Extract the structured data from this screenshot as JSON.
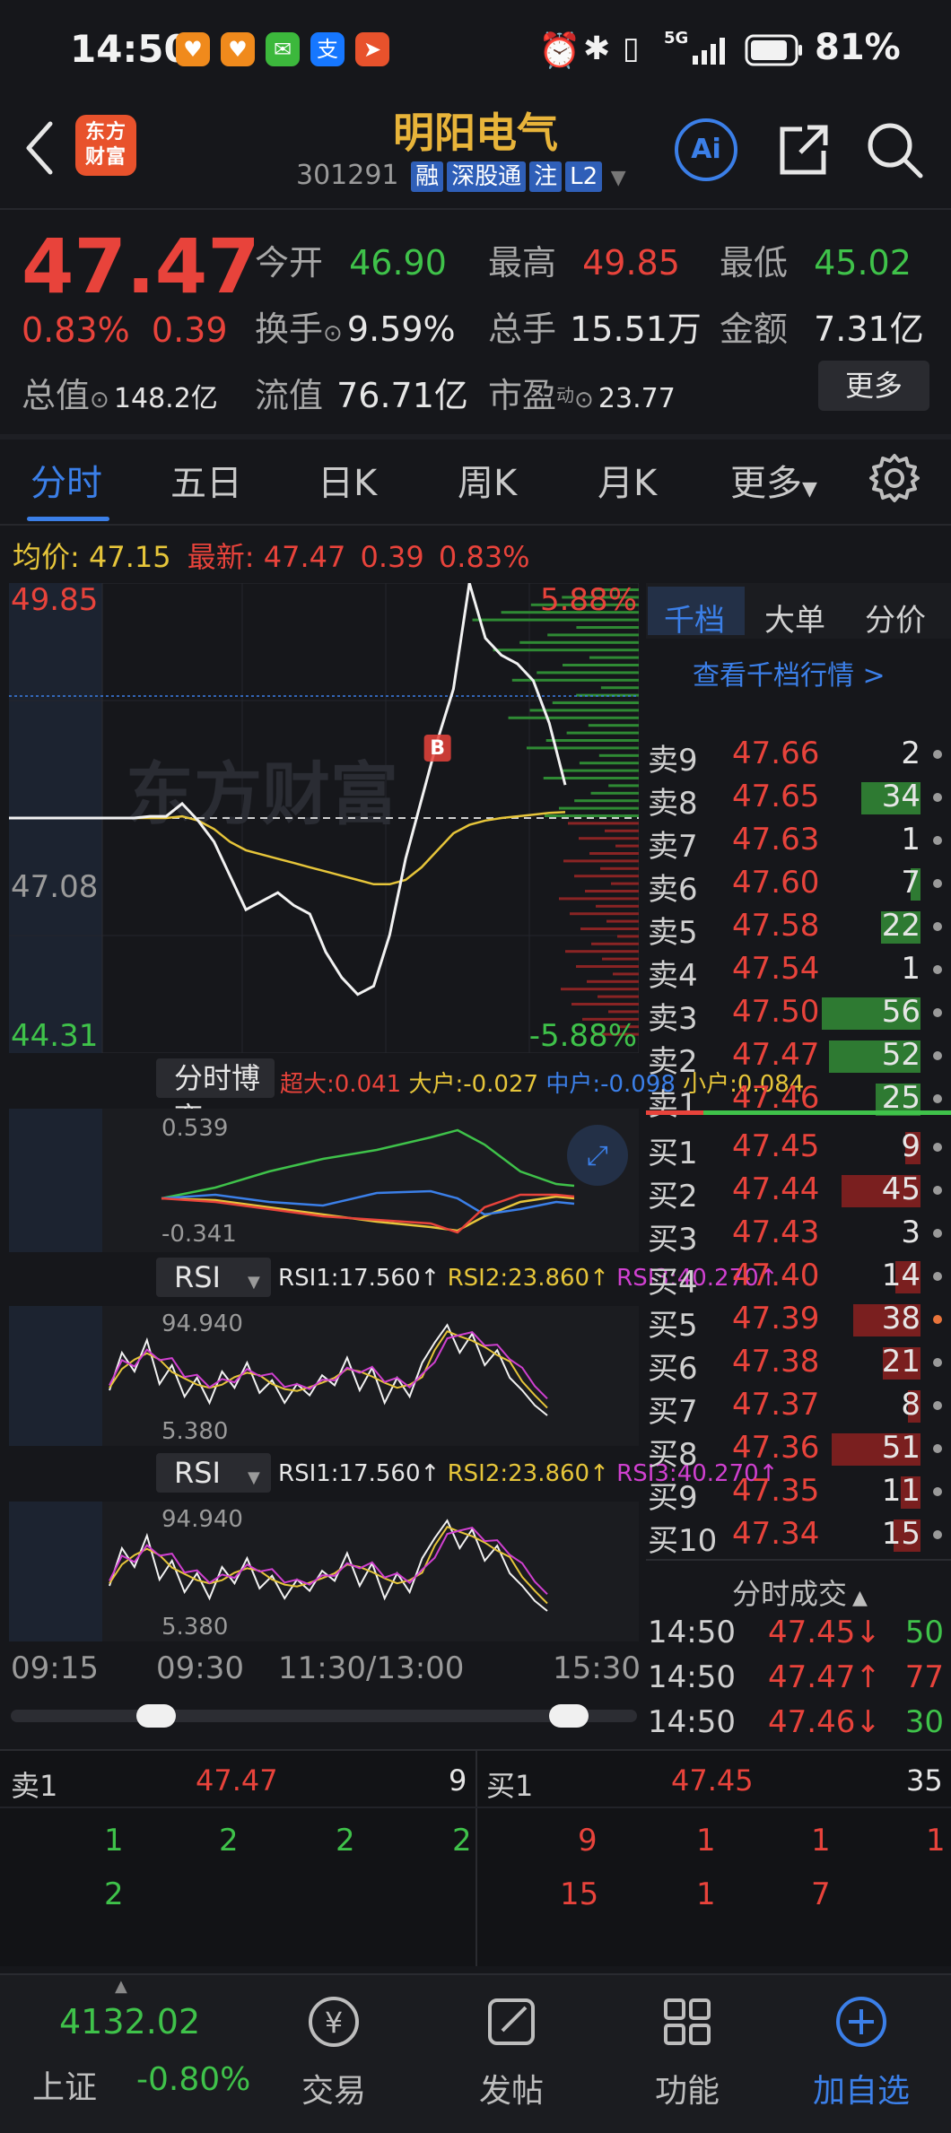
{
  "status_bar": {
    "time": "14:50",
    "battery": "81%",
    "network": "5G"
  },
  "header": {
    "title": "明阳电气",
    "code": "301291",
    "tags": [
      "融",
      "深股通",
      "注",
      "L2"
    ],
    "logo_text": "东方财富",
    "ai_label": "Ai"
  },
  "quote": {
    "price": "47.47",
    "change_pct": "0.83%",
    "change": "0.39",
    "open_label": "今开",
    "open": "46.90",
    "high_label": "最高",
    "high": "49.85",
    "low_label": "最低",
    "low": "45.02",
    "turnover_label": "换手",
    "turnover": "9.59%",
    "volume_label": "总手",
    "volume": "15.51万",
    "amount_label": "金额",
    "amount": "7.31亿",
    "mktcap_label": "总值",
    "mktcap": "148.2亿",
    "float_label": "流值",
    "float_cap": "76.71亿",
    "pe_label": "市盈",
    "pe_sup": "动",
    "pe": "23.77",
    "more_label": "更多"
  },
  "tabs": [
    "分时",
    "五日",
    "日K",
    "周K",
    "月K",
    "更多"
  ],
  "avg_line": {
    "avg_label": "均价:",
    "avg": "47.15",
    "latest_label": "最新:",
    "latest": "47.47",
    "chg": "0.39",
    "pct": "0.83%"
  },
  "chart": {
    "high": "49.85",
    "low": "44.31",
    "prev_close": "47.08",
    "up_pct": "5.88%",
    "down_pct": "-5.88%",
    "watermark": "东方财富",
    "marker": "B",
    "time_labels": [
      "09:15",
      "09:30",
      "11:30/13:00",
      "15:30"
    ]
  },
  "chart_data": {
    "type": "line",
    "title": "",
    "ylim": [
      44.31,
      49.85
    ],
    "prev_close": 47.08,
    "series": [
      {
        "name": "",
        "values": [
          47.08,
          47.08,
          47.08,
          47.1,
          47.1,
          47.25,
          47.05,
          46.8,
          46.4,
          46.0,
          46.1,
          46.2,
          46.05,
          45.95,
          45.5,
          45.2,
          45.0,
          45.1,
          45.7,
          46.6,
          47.3,
          48.0,
          48.6,
          49.85,
          49.2,
          49.0,
          48.9,
          48.7,
          48.2,
          47.47
        ]
      },
      {
        "name": "",
        "values": [
          47.08,
          47.08,
          47.08,
          47.08,
          47.08,
          47.1,
          47.05,
          46.95,
          46.8,
          46.7,
          46.65,
          46.6,
          46.55,
          46.5,
          46.45,
          46.4,
          46.35,
          46.3,
          46.3,
          46.35,
          46.5,
          46.7,
          46.9,
          47.0,
          47.05,
          47.08,
          47.1,
          47.12,
          47.14,
          47.15
        ]
      }
    ]
  },
  "game_panel": {
    "label": "分时博弈",
    "super_large": "超大:0.041",
    "large": "大户:-0.027",
    "medium": "中户:-0.098",
    "small": "小户:0.084",
    "top": "0.539",
    "bottom": "-0.341"
  },
  "rsi_panels": [
    {
      "label": "RSI",
      "rsi1": "RSI1:17.560↑",
      "rsi2": "RSI2:23.860↑",
      "rsi3": "RSI3:40.270↑",
      "top": "94.940",
      "bottom": "5.380"
    },
    {
      "label": "RSI",
      "rsi1": "RSI1:17.560↑",
      "rsi2": "RSI2:23.860↑",
      "rsi3": "RSI3:40.270↑",
      "top": "94.940",
      "bottom": "5.380"
    }
  ],
  "orderbook": {
    "tabs": [
      "千档",
      "大单",
      "分价"
    ],
    "link": "查看千档行情 >",
    "asks": [
      {
        "label": "卖9",
        "price": "47.66",
        "vol": "2",
        "bar": 0.0
      },
      {
        "label": "卖8",
        "price": "47.65",
        "vol": "34",
        "bar": 0.6
      },
      {
        "label": "卖7",
        "price": "47.63",
        "vol": "1",
        "bar": 0.0
      },
      {
        "label": "卖6",
        "price": "47.60",
        "vol": "7",
        "bar": 0.1
      },
      {
        "label": "卖5",
        "price": "47.58",
        "vol": "22",
        "bar": 0.4
      },
      {
        "label": "卖4",
        "price": "47.54",
        "vol": "1",
        "bar": 0.0
      },
      {
        "label": "卖3",
        "price": "47.50",
        "vol": "56",
        "bar": 1.0
      },
      {
        "label": "卖2",
        "price": "47.47",
        "vol": "52",
        "bar": 0.93
      },
      {
        "label": "卖1",
        "price": "47.46",
        "vol": "25",
        "bar": 0.45
      }
    ],
    "bids": [
      {
        "label": "买1",
        "price": "47.45",
        "vol": "9",
        "bar": 0.15
      },
      {
        "label": "买2",
        "price": "47.44",
        "vol": "45",
        "bar": 0.8
      },
      {
        "label": "买3",
        "price": "47.43",
        "vol": "3",
        "bar": 0.0
      },
      {
        "label": "买4",
        "price": "47.40",
        "vol": "14",
        "bar": 0.25
      },
      {
        "label": "买5",
        "price": "47.39",
        "vol": "38",
        "bar": 0.68
      },
      {
        "label": "买6",
        "price": "47.38",
        "vol": "21",
        "bar": 0.38
      },
      {
        "label": "买7",
        "price": "47.37",
        "vol": "8",
        "bar": 0.13
      },
      {
        "label": "买8",
        "price": "47.36",
        "vol": "51",
        "bar": 0.9
      },
      {
        "label": "买9",
        "price": "47.35",
        "vol": "11",
        "bar": 0.2
      },
      {
        "label": "买10",
        "price": "47.34",
        "vol": "15",
        "bar": 0.27
      }
    ],
    "ticks_title": "分时成交",
    "ticks": [
      {
        "time": "14:50",
        "price": "47.45↓",
        "vol": "50"
      },
      {
        "time": "14:50",
        "price": "47.47↑",
        "vol": "77"
      },
      {
        "time": "14:50",
        "price": "47.46↓",
        "vol": "30"
      }
    ]
  },
  "depth": {
    "sell_label": "卖1",
    "sell_price": "47.47",
    "sell_total": "9",
    "buy_label": "买1",
    "buy_price": "47.45",
    "buy_total": "35",
    "sell_row1": [
      "1",
      "2",
      "2",
      "2"
    ],
    "sell_row2": [
      "2"
    ],
    "buy_row1": [
      "9",
      "1",
      "1",
      "1"
    ],
    "buy_row2": [
      "15",
      "1",
      "7"
    ]
  },
  "nav": {
    "index_value": "4132.02",
    "index_name": "上证",
    "index_chg": "-0.80%",
    "items": [
      "交易",
      "发帖",
      "功能",
      "加自选"
    ]
  },
  "colors": {
    "up": "#e8433b",
    "down": "#3fc24a",
    "accent": "#3b7fe8",
    "title": "#e8b43a"
  }
}
